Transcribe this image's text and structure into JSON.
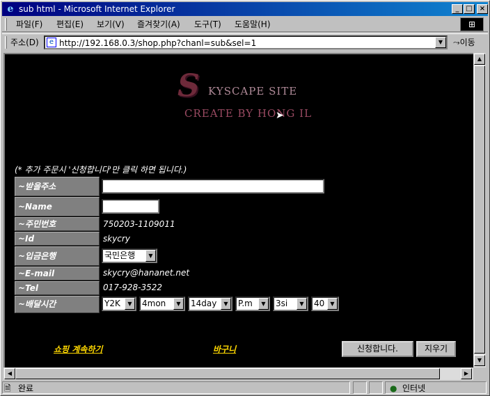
{
  "window": {
    "title": "sub html - Microsoft Internet Explorer",
    "minimize": "_",
    "maximize": "□",
    "close": "×"
  },
  "menu": {
    "items": [
      "파일(F)",
      "편집(E)",
      "보기(V)",
      "즐겨찾기(A)",
      "도구(T)",
      "도움말(H)"
    ]
  },
  "address": {
    "label": "주소(D)",
    "url": "http://192.168.0.3/shop.php?chanl=sub&sel=1",
    "go_label": "이동"
  },
  "logo": {
    "letter": "S",
    "line1": "KYSCAPE SITE",
    "line2": "CREATE BY HONG IL"
  },
  "form": {
    "notice": "(* 추가 주문시 '신청합니다'만 클릭 하면 됩니다.)",
    "fields": [
      {
        "label": "~받을주소",
        "value": ""
      },
      {
        "label": "~Name",
        "value": ""
      },
      {
        "label": "~주민번호",
        "value": "750203-1109011"
      },
      {
        "label": "~Id",
        "value": "skycry"
      },
      {
        "label": "~입금은행",
        "value": "국민은행"
      },
      {
        "label": "~E-mail",
        "value": "skycry@hananet.net"
      },
      {
        "label": "~Tel",
        "value": "017-928-3522"
      },
      {
        "label": "~배달시간",
        "value": ""
      }
    ],
    "delivery_time": {
      "year": "Y2K",
      "month": "4mon",
      "day": "14day",
      "ampm": "P.m",
      "hour": "3si",
      "minute": "40"
    }
  },
  "actions": {
    "continue_shopping": "쇼핑 계속하기",
    "cart": "바구니",
    "submit": "신청합니다.",
    "clear": "지우기"
  },
  "status": {
    "text": "완료",
    "zone": "인터넷"
  }
}
